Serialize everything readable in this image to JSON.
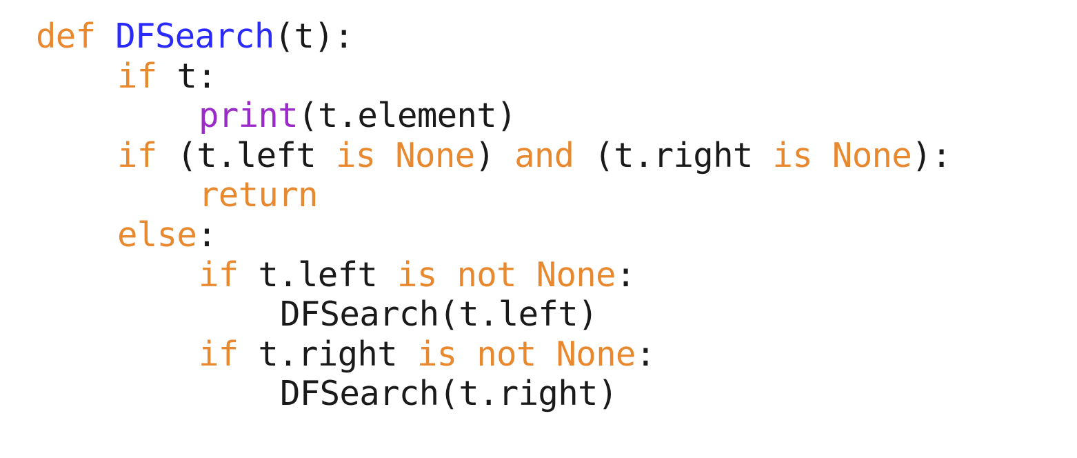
{
  "colors": {
    "keyword": "#e8892f",
    "function_name": "#2a2afa",
    "builtin": "#9b2bc8",
    "plain": "#1a1a1a",
    "background": "#ffffff"
  },
  "code": {
    "line1": {
      "kw_def": "def",
      "sp": " ",
      "fn_name": "DFSearch",
      "rest": "(t):"
    },
    "line2": {
      "kw_if": "if",
      "rest": " t:"
    },
    "line3": {
      "builtin_print": "print",
      "rest": "(t.element)"
    },
    "line4": {
      "kw_if": "if",
      "part1": " (t.left ",
      "kw_is1": "is",
      "sp1": " ",
      "kw_none1": "None",
      "part2": ") ",
      "kw_and": "and",
      "part3": " (t.right ",
      "kw_is2": "is",
      "sp2": " ",
      "kw_none2": "None",
      "part4": "):"
    },
    "line5": {
      "kw_return": "return"
    },
    "line6": {
      "kw_else": "else",
      "rest": ":"
    },
    "line7": {
      "kw_if": "if",
      "part1": " t.left ",
      "kw_is": "is",
      "sp1": " ",
      "kw_not": "not",
      "sp2": " ",
      "kw_none": "None",
      "rest": ":"
    },
    "line8": {
      "call": "DFSearch(t.left)"
    },
    "line9": {
      "kw_if": "if",
      "part1": " t.right ",
      "kw_is": "is",
      "sp1": " ",
      "kw_not": "not",
      "sp2": " ",
      "kw_none": "None",
      "rest": ":"
    },
    "line10": {
      "call": "DFSearch(t.right)"
    }
  }
}
